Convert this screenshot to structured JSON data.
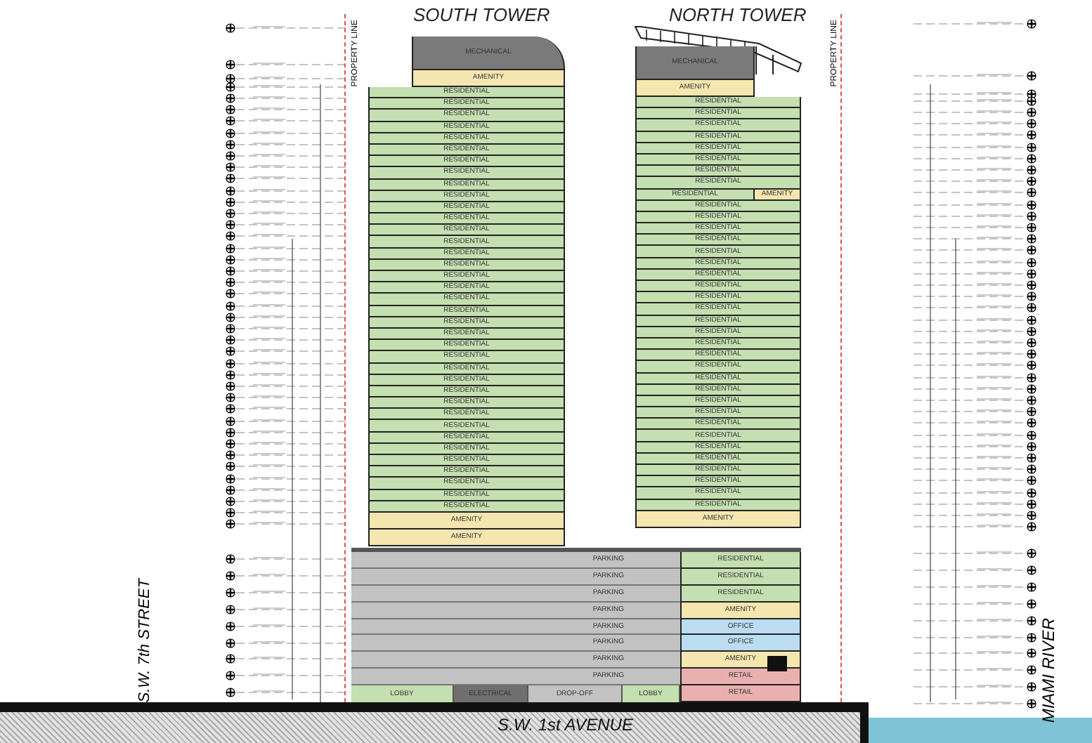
{
  "titles": [
    "SOUTH TOWER",
    "NORTH TOWER"
  ],
  "property_lines": [
    "PROPERTY LINE",
    "PROPERTY LINE"
  ],
  "towers": [
    {
      "floors": [
        {
          "use": "MECHANICAL",
          "kind": "mechanical"
        },
        {
          "use": "AMENITY",
          "kind": "amenity"
        },
        {
          "use": "RESIDENTIAL",
          "kind": "residential"
        },
        {
          "use": "RESIDENTIAL",
          "kind": "residential"
        },
        {
          "use": "RESIDENTIAL",
          "kind": "residential"
        },
        {
          "use": "RESIDENTIAL",
          "kind": "residential"
        },
        {
          "use": "RESIDENTIAL",
          "kind": "residential"
        },
        {
          "use": "RESIDENTIAL",
          "kind": "residential"
        },
        {
          "use": "RESIDENTIAL",
          "kind": "residential"
        },
        {
          "use": "RESIDENTIAL",
          "kind": "residential"
        },
        {
          "use": "RESIDENTIAL",
          "kind": "residential"
        },
        {
          "use": "RESIDENTIAL",
          "kind": "residential"
        },
        {
          "use": "RESIDENTIAL",
          "kind": "residential"
        },
        {
          "use": "RESIDENTIAL",
          "kind": "residential"
        },
        {
          "use": "RESIDENTIAL",
          "kind": "residential"
        },
        {
          "use": "RESIDENTIAL",
          "kind": "residential"
        },
        {
          "use": "RESIDENTIAL",
          "kind": "residential"
        },
        {
          "use": "RESIDENTIAL",
          "kind": "residential"
        },
        {
          "use": "RESIDENTIAL",
          "kind": "residential"
        },
        {
          "use": "RESIDENTIAL",
          "kind": "residential"
        },
        {
          "use": "RESIDENTIAL",
          "kind": "residential"
        },
        {
          "use": "RESIDENTIAL",
          "kind": "residential"
        },
        {
          "use": "RESIDENTIAL",
          "kind": "residential"
        },
        {
          "use": "RESIDENTIAL",
          "kind": "residential"
        },
        {
          "use": "RESIDENTIAL",
          "kind": "residential"
        },
        {
          "use": "RESIDENTIAL",
          "kind": "residential"
        },
        {
          "use": "RESIDENTIAL",
          "kind": "residential"
        },
        {
          "use": "RESIDENTIAL",
          "kind": "residential"
        },
        {
          "use": "RESIDENTIAL",
          "kind": "residential"
        },
        {
          "use": "RESIDENTIAL",
          "kind": "residential"
        },
        {
          "use": "RESIDENTIAL",
          "kind": "residential"
        },
        {
          "use": "RESIDENTIAL",
          "kind": "residential"
        },
        {
          "use": "RESIDENTIAL",
          "kind": "residential"
        },
        {
          "use": "RESIDENTIAL",
          "kind": "residential"
        },
        {
          "use": "RESIDENTIAL",
          "kind": "residential"
        },
        {
          "use": "RESIDENTIAL",
          "kind": "residential"
        },
        {
          "use": "RESIDENTIAL",
          "kind": "residential"
        },
        {
          "use": "RESIDENTIAL",
          "kind": "residential"
        },
        {
          "use": "RESIDENTIAL",
          "kind": "residential"
        },
        {
          "use": "AMENITY",
          "kind": "amenity"
        },
        {
          "use": "AMENITY",
          "kind": "amenity"
        }
      ]
    },
    {
      "floors": [
        {
          "use": "MECHANICAL",
          "kind": "mechanical"
        },
        {
          "use": "AMENITY",
          "kind": "amenity"
        },
        {
          "use": "RESIDENTIAL",
          "kind": "residential"
        },
        {
          "use": "RESIDENTIAL",
          "kind": "residential"
        },
        {
          "use": "RESIDENTIAL",
          "kind": "residential"
        },
        {
          "use": "RESIDENTIAL",
          "kind": "residential"
        },
        {
          "use": "RESIDENTIAL",
          "kind": "residential"
        },
        {
          "use": "RESIDENTIAL",
          "kind": "residential"
        },
        {
          "use": "RESIDENTIAL",
          "kind": "residential"
        },
        {
          "use": "RESIDENTIAL",
          "kind": "residential"
        },
        {
          "use": "RESIDENTIAL",
          "kind": "residential",
          "side": {
            "use": "AMENITY",
            "kind": "amenity"
          }
        },
        {
          "use": "RESIDENTIAL",
          "kind": "residential"
        },
        {
          "use": "RESIDENTIAL",
          "kind": "residential"
        },
        {
          "use": "RESIDENTIAL",
          "kind": "residential"
        },
        {
          "use": "RESIDENTIAL",
          "kind": "residential"
        },
        {
          "use": "RESIDENTIAL",
          "kind": "residential"
        },
        {
          "use": "RESIDENTIAL",
          "kind": "residential"
        },
        {
          "use": "RESIDENTIAL",
          "kind": "residential"
        },
        {
          "use": "RESIDENTIAL",
          "kind": "residential"
        },
        {
          "use": "RESIDENTIAL",
          "kind": "residential"
        },
        {
          "use": "RESIDENTIAL",
          "kind": "residential"
        },
        {
          "use": "RESIDENTIAL",
          "kind": "residential"
        },
        {
          "use": "RESIDENTIAL",
          "kind": "residential"
        },
        {
          "use": "RESIDENTIAL",
          "kind": "residential"
        },
        {
          "use": "RESIDENTIAL",
          "kind": "residential"
        },
        {
          "use": "RESIDENTIAL",
          "kind": "residential"
        },
        {
          "use": "RESIDENTIAL",
          "kind": "residential"
        },
        {
          "use": "RESIDENTIAL",
          "kind": "residential"
        },
        {
          "use": "RESIDENTIAL",
          "kind": "residential"
        },
        {
          "use": "RESIDENTIAL",
          "kind": "residential"
        },
        {
          "use": "RESIDENTIAL",
          "kind": "residential"
        },
        {
          "use": "RESIDENTIAL",
          "kind": "residential"
        },
        {
          "use": "RESIDENTIAL",
          "kind": "residential"
        },
        {
          "use": "RESIDENTIAL",
          "kind": "residential"
        },
        {
          "use": "RESIDENTIAL",
          "kind": "residential"
        },
        {
          "use": "RESIDENTIAL",
          "kind": "residential"
        },
        {
          "use": "RESIDENTIAL",
          "kind": "residential"
        },
        {
          "use": "RESIDENTIAL",
          "kind": "residential"
        },
        {
          "use": "AMENITY",
          "kind": "amenity"
        }
      ]
    }
  ],
  "podium": {
    "parking": [
      "PARKING",
      "PARKING",
      "PARKING",
      "PARKING",
      "PARKING",
      "PARKING",
      "PARKING",
      "PARKING"
    ],
    "ground": [
      {
        "use": "LOBBY",
        "kind": "lobby"
      },
      {
        "use": "ELECTRICAL",
        "kind": "electrical"
      },
      {
        "use": "DROP-OFF",
        "kind": "dropoff"
      },
      {
        "use": "LOBBY",
        "kind": "lobby"
      }
    ],
    "north_stack": [
      {
        "use": "RESIDENTIAL",
        "kind": "residential"
      },
      {
        "use": "RESIDENTIAL",
        "kind": "residential"
      },
      {
        "use": "RESIDENTIAL",
        "kind": "residential"
      },
      {
        "use": "AMENITY",
        "kind": "amenity"
      },
      {
        "use": "OFFICE",
        "kind": "office"
      },
      {
        "use": "OFFICE",
        "kind": "office"
      },
      {
        "use": "AMENITY",
        "kind": "amenity"
      },
      {
        "use": "RETAIL",
        "kind": "retail"
      },
      {
        "use": "RETAIL",
        "kind": "retail"
      }
    ]
  },
  "streets": {
    "west": "S.W. 7th STREET",
    "south": "S.W. 1st AVENUE",
    "river": "MIAMI RIVER"
  }
}
